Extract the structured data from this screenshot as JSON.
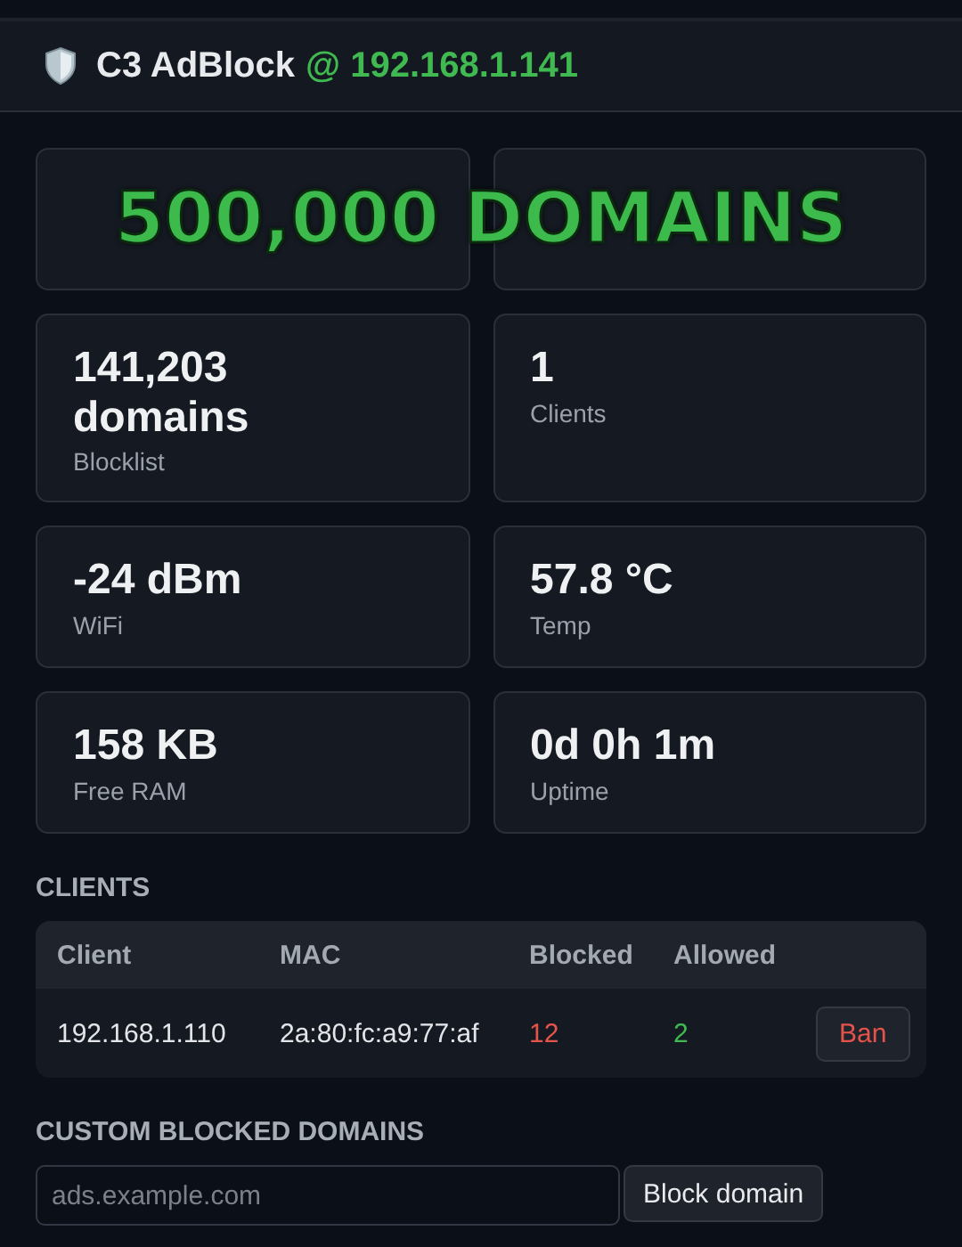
{
  "header": {
    "app_name": "C3 AdBlock",
    "address": "@ 192.168.1.141"
  },
  "caption": "500,000 DOMAINS",
  "stats": [
    {
      "value": "141,203 domains",
      "label": "Blocklist"
    },
    {
      "value": "1",
      "label": "Clients"
    },
    {
      "value": "-24 dBm",
      "label": "WiFi"
    },
    {
      "value": "57.8 °C",
      "label": "Temp"
    },
    {
      "value": "158 KB",
      "label": "Free RAM"
    },
    {
      "value": "0d 0h 1m",
      "label": "Uptime"
    }
  ],
  "clients": {
    "title": "CLIENTS",
    "columns": [
      "Client",
      "MAC",
      "Blocked",
      "Allowed"
    ],
    "rows": [
      {
        "client": "192.168.1.110",
        "mac": "2a:80:fc:a9:77:af",
        "blocked": "12",
        "allowed": "2",
        "action": "Ban"
      }
    ]
  },
  "custom_blocked": {
    "title": "CUSTOM BLOCKED DOMAINS",
    "placeholder": "ads.example.com",
    "button": "Block domain"
  }
}
